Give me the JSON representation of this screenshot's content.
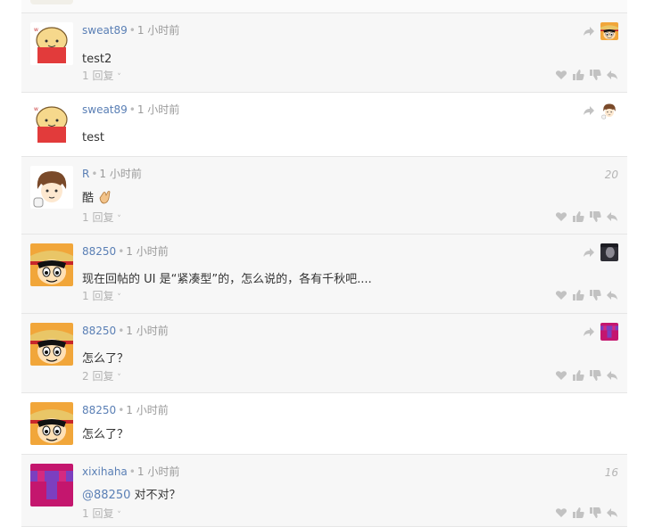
{
  "colors": {
    "username": "#5a7fb5",
    "meta": "#9a9a9a",
    "icon": "#c2c2c2",
    "text": "#333333"
  },
  "comments": [
    {
      "user": "sweat89",
      "time": "1 小时前",
      "body": "test2",
      "replies": "1 回复",
      "avatar": "bread-face-avatar",
      "floor": "",
      "corner_avatar": "luffy-mini"
    },
    {
      "user": "sweat89",
      "time": "1 小时前",
      "body": "test",
      "replies": "",
      "avatar": "bread-face-avatar",
      "floor": "",
      "corner_avatar": "brown-hair-mini"
    },
    {
      "user": "R",
      "time": "1 小时前",
      "body": "酷",
      "replies": "1 回复",
      "avatar": "brown-hair-avatar",
      "floor": "20",
      "corner_avatar": ""
    },
    {
      "user": "88250",
      "time": "1 小时前",
      "body": "现在回帖的 UI 是“紧凑型”的，怎么说的，各有千秋吧....",
      "replies": "1 回复",
      "avatar": "luffy-avatar",
      "floor": "",
      "corner_avatar": "dark-portrait-mini"
    },
    {
      "user": "88250",
      "time": "1 小时前",
      "body": "怎么了？",
      "replies": "2 回复",
      "avatar": "luffy-avatar",
      "floor": "",
      "corner_avatar": "magenta-pattern-mini"
    },
    {
      "user": "88250",
      "time": "1 小时前",
      "body": "怎么了？",
      "replies": "",
      "avatar": "luffy-avatar",
      "floor": "",
      "corner_avatar": ""
    },
    {
      "user": "xixihaha",
      "time": "1 小时前",
      "body_mention": "@88250",
      "body_rest": " 对不对？",
      "replies": "1 回复",
      "avatar": "magenta-pattern-avatar",
      "floor": "16",
      "corner_avatar": ""
    }
  ]
}
